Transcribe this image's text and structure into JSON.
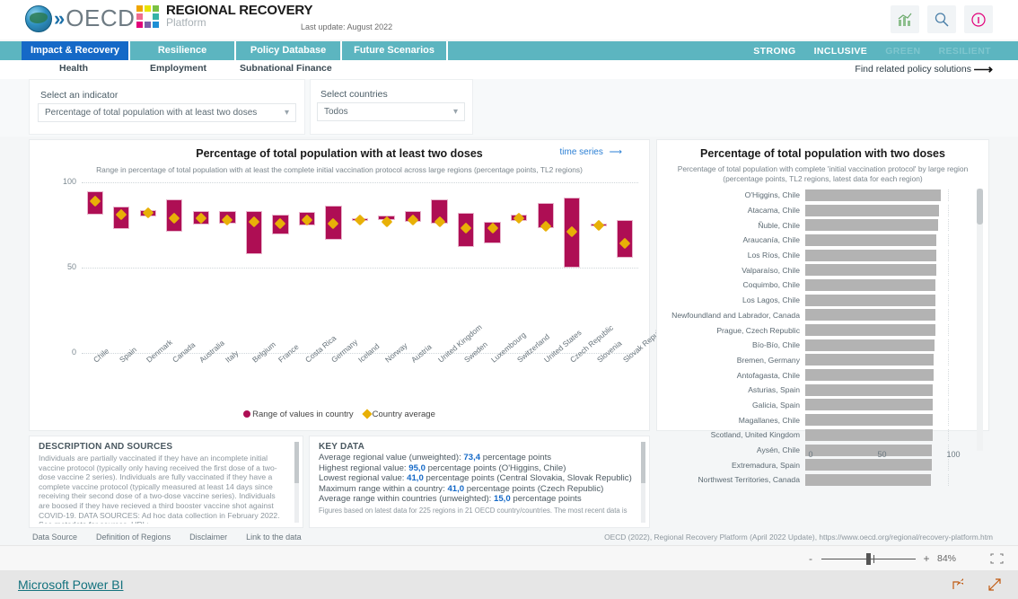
{
  "header": {
    "logo_text": "OECD",
    "platform_title": "REGIONAL RECOVERY",
    "platform_sub": "Platform",
    "last_update": "Last update: August 2022",
    "icons": [
      {
        "name": "chart-icon",
        "glyph": "▦"
      },
      {
        "name": "search-icon",
        "glyph": "⚲"
      },
      {
        "name": "info-icon",
        "glyph": "ⓘ"
      }
    ]
  },
  "tabs": [
    {
      "label": "Impact & Recovery",
      "active": true
    },
    {
      "label": "Resilience",
      "active": false
    },
    {
      "label": "Policy Database",
      "active": false
    },
    {
      "label": "Future Scenarios",
      "active": false
    }
  ],
  "pillars": [
    {
      "label": "STRONG",
      "active": true
    },
    {
      "label": "INCLUSIVE",
      "active": true
    },
    {
      "label": "GREEN",
      "active": false
    },
    {
      "label": "RESILIENT",
      "active": false
    }
  ],
  "subnav": {
    "items": [
      "Health",
      "Employment",
      "Subnational Finance"
    ],
    "find_policy": "Find related policy solutions"
  },
  "filters": {
    "indicator_label": "Select an indicator",
    "indicator_value": "Percentage of total population with at least two doses",
    "countries_label": "Select countries",
    "countries_value": "Todos"
  },
  "left_panel": {
    "title": "Percentage of total population with at least two doses",
    "subtitle": "Range in percentage of total population with at least the complete initial vaccination protocol across large regions (percentage points, TL2 regions)",
    "time_series_link": "time series",
    "legend": [
      "Range of values in country",
      "Country average"
    ]
  },
  "right_panel": {
    "title": "Percentage of total population with two doses",
    "subtitle": "Percentage of total population with complete 'initial vaccination protocol' by large region (percentage points, TL2 regions, latest data for each region)"
  },
  "description": {
    "heading": "DESCRIPTION AND SOURCES",
    "body": "Individuals are partially vaccinated if they have an incomplete initial vaccine protocol (typically only having received the first dose of a two-dose vaccine 2 series). Individuals are fully vaccinated if they have a complete vaccine protocol (typically measured at least 14 days since receiving their second dose of a two-dose vaccine series). Individuals are boosed if they have recieved a third booster vaccine shot against COVID-19. DATA SOURCES: Ad hoc data collection in February 2022. See metadata for sources. URL:"
  },
  "key_data": {
    "heading": "KEY DATA",
    "lines": [
      {
        "pre": "Average regional value (unweighted): ",
        "value": "73,4",
        "post": " percentage points"
      },
      {
        "pre": "Highest regional value: ",
        "value": "95,0",
        "post": " percentage points (O'Higgins, Chile)"
      },
      {
        "pre": "Lowest regional value: ",
        "value": "41,0",
        "post": " percentage points (Central Slovakia, Slovak Republic)"
      },
      {
        "pre": "Maximum range within a country: ",
        "value": "41,0",
        "post": " percentage points (Czech Republic)"
      },
      {
        "pre": "Average range within countries (unweighted): ",
        "value": "15,0",
        "post": " percentage points"
      }
    ],
    "footnote": "Figures based on latest data for 225 regions in 21 OECD country/countries. The most recent data is"
  },
  "footer": {
    "links": [
      "Data Source",
      "Definition of Regions",
      "Disclaimer",
      "Link to the data"
    ],
    "source": "OECD (2022), Regional Recovery Platform (April 2022 Update), https://www.oecd.org/regional/recovery-platform.htm"
  },
  "powerbi": {
    "zoom_minus": "-",
    "zoom_plus": "+",
    "zoom_level": "84%",
    "fit_icon": "⬚",
    "brand": "Microsoft Power BI",
    "share_icon": "↪",
    "fullscreen_icon": "↗"
  },
  "chart_data": [
    {
      "type": "bar",
      "id": "country-ranges",
      "title": "Percentage of total population with at least two doses",
      "subtitle": "Range in percentage of total population with at least the complete initial vaccination protocol across large regions (percentage points, TL2 regions)",
      "xlabel": "",
      "ylabel": "",
      "ylim": [
        0,
        100
      ],
      "yticks": [
        0,
        50,
        100
      ],
      "grid": true,
      "legend_position": "bottom",
      "legend": [
        "Range of values in country",
        "Country average"
      ],
      "colors": {
        "range": "#ae0e54",
        "average": "#e8b007"
      },
      "categories": [
        "Chile",
        "Spain",
        "Denmark",
        "Canada",
        "Australia",
        "Italy",
        "Belgium",
        "France",
        "Costa Rica",
        "Germany",
        "Iceland",
        "Norway",
        "Austria",
        "United Kingdom",
        "Sweden",
        "Luxembourg",
        "Switzerland",
        "United States",
        "Czech Republic",
        "Slovenia",
        "Slovak Republic"
      ],
      "series": [
        {
          "name": "Range min",
          "values": [
            81.0,
            72.5,
            80.0,
            71.0,
            75.0,
            76.0,
            58.0,
            69.5,
            75.0,
            66.5,
            77.5,
            78.0,
            77.0,
            76.0,
            62.0,
            64.0,
            77.5,
            73.0,
            50.0,
            74.5,
            56.0
          ]
        },
        {
          "name": "Range max",
          "values": [
            95.0,
            86.0,
            83.5,
            90.0,
            83.0,
            83.0,
            83.0,
            81.0,
            82.5,
            86.5,
            79.0,
            80.5,
            83.0,
            90.0,
            82.0,
            77.0,
            81.0,
            88.0,
            91.0,
            76.0,
            78.0
          ]
        },
        {
          "name": "Country average",
          "values": [
            89.0,
            81.0,
            82.0,
            79.0,
            79.0,
            78.0,
            77.0,
            76.0,
            78.0,
            76.0,
            78.0,
            77.0,
            78.0,
            77.0,
            73.0,
            73.0,
            79.0,
            74.0,
            71.0,
            75.0,
            64.0
          ]
        }
      ]
    },
    {
      "type": "bar",
      "id": "region-values",
      "orientation": "horizontal",
      "title": "Percentage of total population with two doses",
      "subtitle": "Percentage of total population with complete 'initial vaccination protocol' by large region (percentage points, TL2 regions, latest data for each region)",
      "xlabel": "",
      "ylabel": "",
      "xlim": [
        0,
        100
      ],
      "xticks": [
        0,
        50,
        100
      ],
      "grid": true,
      "color": "#b3b3b3",
      "categories": [
        "O'Higgins, Chile",
        "Atacama, Chile",
        "Ñuble, Chile",
        "Araucanía, Chile",
        "Los Ríos, Chile",
        "Valparaíso, Chile",
        "Coquimbo, Chile",
        "Los Lagos, Chile",
        "Newfoundland and Labrador, Canada",
        "Prague, Czech Republic",
        "Bío-Bío, Chile",
        "Bremen, Germany",
        "Antofagasta, Chile",
        "Asturias, Spain",
        "Galicia, Spain",
        "Magallanes, Chile",
        "Scotland, United Kingdom",
        "Aysén, Chile",
        "Extremadura, Spain",
        "Northwest Territories, Canada"
      ],
      "values": [
        95.0,
        93.5,
        93.3,
        92.0,
        92.0,
        92.0,
        91.5,
        91.5,
        91.5,
        91.0,
        90.5,
        90.0,
        90.0,
        89.5,
        89.2,
        89.0,
        89.0,
        88.5,
        88.5,
        88.3
      ]
    }
  ]
}
